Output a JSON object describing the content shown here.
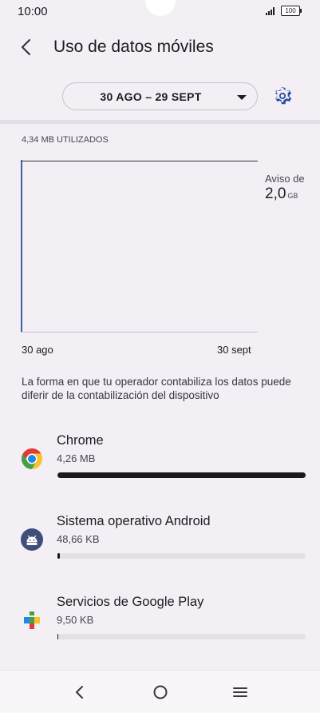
{
  "status": {
    "time": "10:00",
    "battery": "100"
  },
  "header": {
    "title": "Uso de datos móviles"
  },
  "cycle": {
    "range": "30 AGO – 29 SEPT"
  },
  "usage": {
    "used_label": "4,34 MB UTILIZADOS",
    "warning_label": "Aviso de",
    "warning_value": "2,0",
    "warning_unit": "GB",
    "start_date": "30 ago",
    "end_date": "30 sept",
    "note": "La forma en que tu operador contabiliza los datos puede diferir de la contabilización del dispositivo"
  },
  "apps": [
    {
      "name": "Chrome",
      "size": "4,26 MB",
      "share": 1.0,
      "icon": "chrome-icon"
    },
    {
      "name": "Sistema operativo Android",
      "size": "48,66 KB",
      "share": 0.011,
      "icon": "android-icon"
    },
    {
      "name": "Servicios de Google Play",
      "size": "9,50 KB",
      "share": 0.002,
      "icon": "google-play-services-icon"
    }
  ],
  "colors": {
    "background": "#f3eff4",
    "chart_line": "#3f5ea8",
    "accent": "#2d4fa0"
  }
}
